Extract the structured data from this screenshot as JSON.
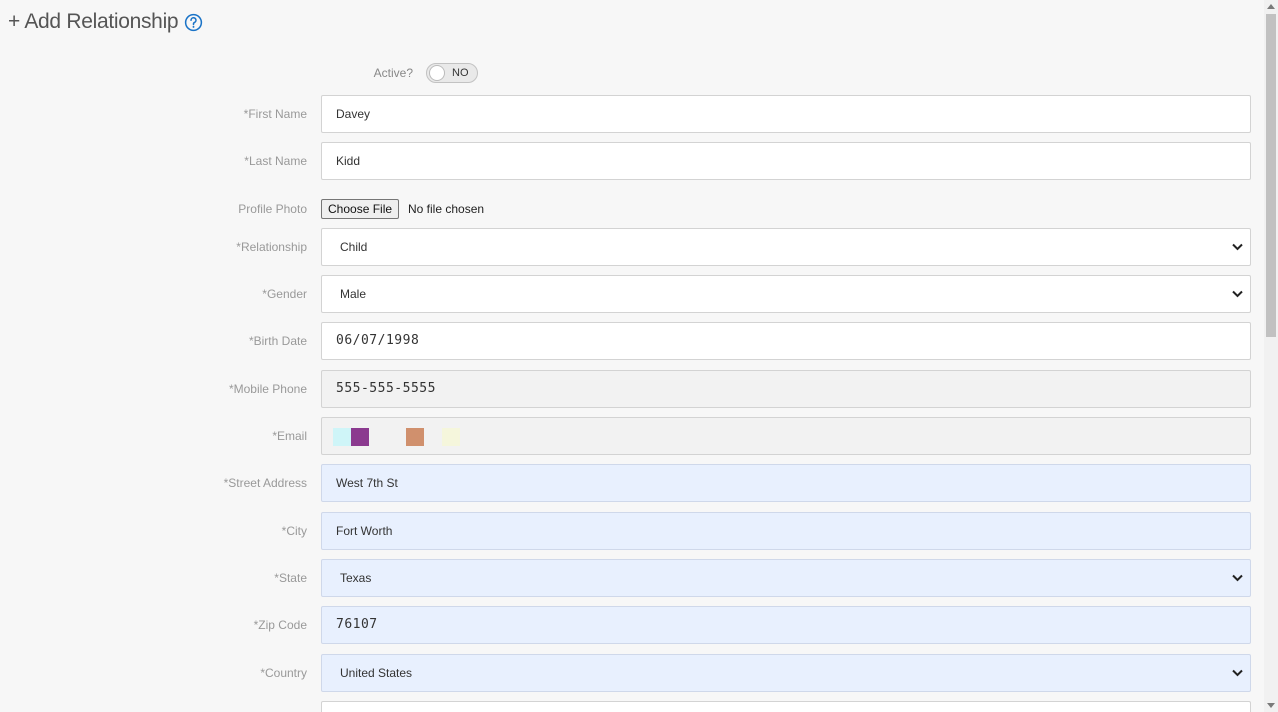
{
  "header": {
    "title": "+ Add Relationship",
    "help_icon": "question-circle-icon"
  },
  "active": {
    "label": "Active?",
    "value": "NO"
  },
  "form": {
    "first_name": {
      "label": "*First Name",
      "value": "Davey"
    },
    "last_name": {
      "label": "*Last Name",
      "value": "Kidd"
    },
    "profile_photo": {
      "label": "Profile Photo",
      "button": "Choose File",
      "status": "No file chosen"
    },
    "relationship": {
      "label": "*Relationship",
      "value": "Child"
    },
    "gender": {
      "label": "*Gender",
      "value": "Male"
    },
    "birth_date": {
      "label": "*Birth Date",
      "value": "06/07/1998"
    },
    "mobile_phone": {
      "label": "*Mobile Phone",
      "value": "555-555-5555"
    },
    "email": {
      "label": "*Email",
      "swatches": [
        "#cff5f8",
        "#8b3a8f",
        "#d0906d",
        "#f5f6dc"
      ]
    },
    "street_address": {
      "label": "*Street Address",
      "value": "West 7th St"
    },
    "city": {
      "label": "*City",
      "value": "Fort Worth"
    },
    "state": {
      "label": "*State",
      "value": "Texas"
    },
    "zip_code": {
      "label": "*Zip Code",
      "value": "76107"
    },
    "country": {
      "label": "*Country",
      "value": "United States"
    }
  }
}
